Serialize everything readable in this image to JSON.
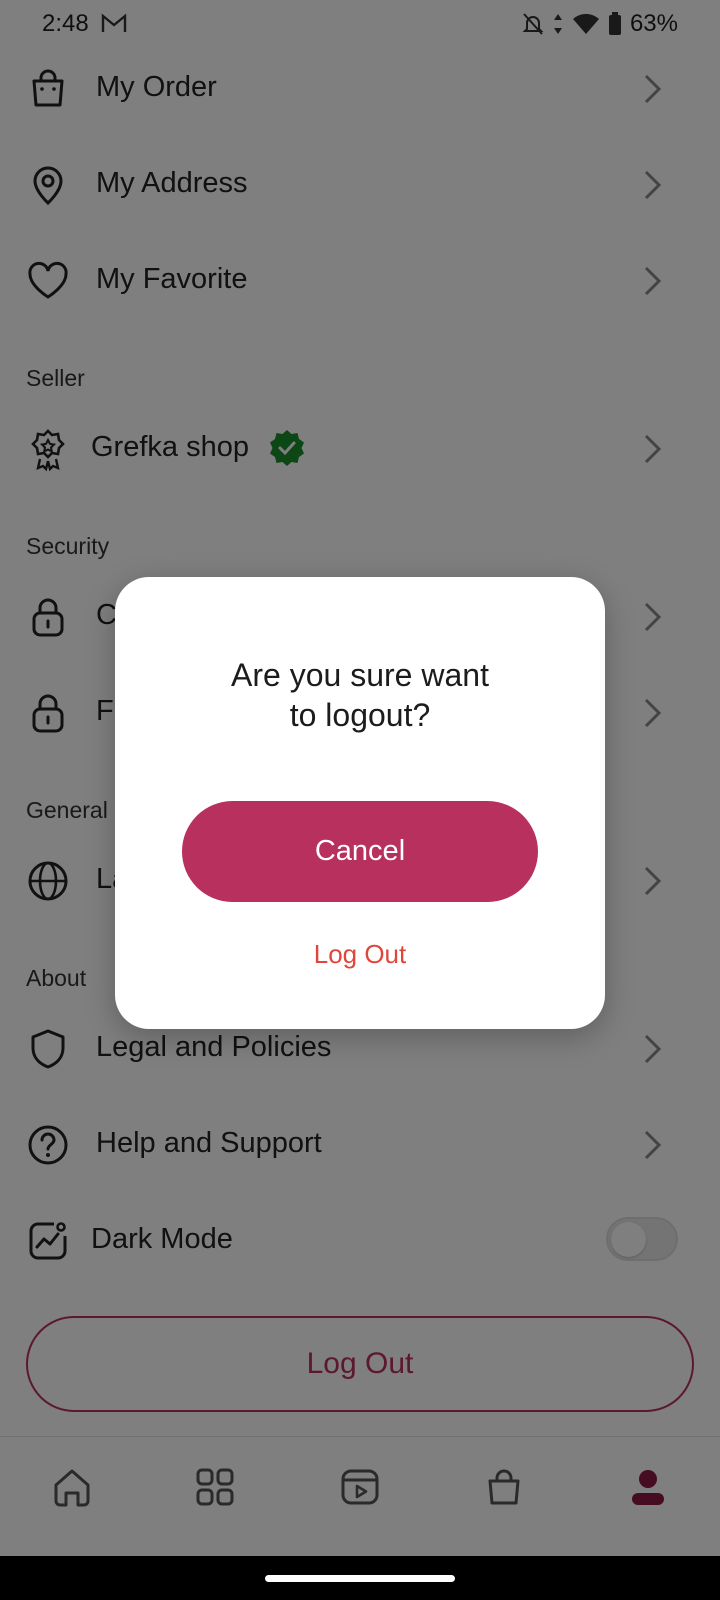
{
  "status_bar": {
    "time": "2:48",
    "battery": "63%"
  },
  "menu": {
    "my_order": "My Order",
    "my_address": "My Address",
    "my_favorite": "My Favorite",
    "seller_section": "Seller",
    "shop_name": "Grefka shop",
    "security_section": "Security",
    "security_item_1_partial": "C",
    "security_item_2_partial": "Fo",
    "general_section": "General",
    "general_item_partial": "La",
    "about_section": "About",
    "legal": "Legal and Policies",
    "help": "Help and Support",
    "dark_mode": "Dark Mode",
    "logout": "Log Out"
  },
  "dialog": {
    "title_line1": "Are you sure want",
    "title_line2": "to logout?",
    "cancel": "Cancel",
    "logout": "Log Out"
  },
  "colors": {
    "accent": "#b8305e",
    "danger": "#e0463b",
    "verified": "#1a8f2a"
  },
  "icons": [
    "bag-icon",
    "location-pin-icon",
    "heart-icon",
    "badge-icon",
    "verified-icon",
    "lock-icon",
    "globe-icon",
    "shield-icon",
    "help-icon",
    "chart-icon",
    "chevron-right-icon",
    "home-icon",
    "grid-icon",
    "video-icon",
    "cart-icon",
    "profile-icon"
  ]
}
